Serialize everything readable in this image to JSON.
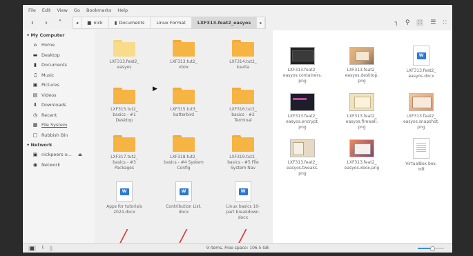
{
  "menu": [
    "File",
    "Edit",
    "View",
    "Go",
    "Bookmarks",
    "Help"
  ],
  "breadcrumbs": [
    {
      "label": "nick",
      "icon": "home-icon"
    },
    {
      "label": "Documents",
      "icon": "folder-icon"
    },
    {
      "label": "Linux Format",
      "icon": ""
    },
    {
      "label": "LXF313.feat2_easyos",
      "icon": ""
    }
  ],
  "sidebar": {
    "my_computer": "My Computer",
    "items": [
      {
        "label": "Home",
        "icon": "home-icon"
      },
      {
        "label": "Desktop",
        "icon": "desktop-icon"
      },
      {
        "label": "Documents",
        "icon": "documents-icon"
      },
      {
        "label": "Music",
        "icon": "music-icon"
      },
      {
        "label": "Pictures",
        "icon": "pictures-icon"
      },
      {
        "label": "Videos",
        "icon": "videos-icon"
      },
      {
        "label": "Downloads",
        "icon": "downloads-icon"
      },
      {
        "label": "Recent",
        "icon": "recent-icon"
      },
      {
        "label": "File System",
        "icon": "file-system-icon"
      },
      {
        "label": "Rubbish Bin",
        "icon": "rubbish-bin-icon"
      }
    ],
    "network_header": "Network",
    "network_items": [
      {
        "label": "nickpeers-o...",
        "icon": "computer-icon"
      },
      {
        "label": "Network",
        "icon": "network-icon"
      }
    ]
  },
  "left_items": [
    {
      "type": "folder-light",
      "lines": [
        "LXF313.feat2_",
        "easyos"
      ]
    },
    {
      "type": "folder",
      "lines": [
        "LXF313.tut2_",
        "vbox"
      ]
    },
    {
      "type": "folder",
      "lines": [
        "LXF314.tut2_",
        "kavita"
      ]
    },
    {
      "type": "folder",
      "lines": [
        "LXF315.tut2_",
        "basics - #1",
        "Desktop"
      ]
    },
    {
      "type": "folder",
      "lines": [
        "LXF315.tut3_",
        "batterbird"
      ]
    },
    {
      "type": "folder",
      "lines": [
        "LXF316.tut2_",
        "basics - #2",
        "Terminal"
      ]
    },
    {
      "type": "folder",
      "lines": [
        "LXF317.tut2_",
        "basics - #3",
        "Packages"
      ]
    },
    {
      "type": "folder",
      "lines": [
        "LXF318.tut2_",
        "basics - #4 System",
        "Config"
      ]
    },
    {
      "type": "folder",
      "lines": [
        "LXF319.tut2_",
        "basics - #5 File",
        "System Nav"
      ]
    },
    {
      "type": "docx",
      "lines": [
        "Apps for tutorials",
        "2024.docx"
      ]
    },
    {
      "type": "docx",
      "lines": [
        "Contribution List.",
        "docx"
      ]
    },
    {
      "type": "docx",
      "lines": [
        "Linux basics 10-",
        "part breakdown.",
        "docx"
      ]
    },
    {
      "type": "pdf",
      "lines": []
    },
    {
      "type": "pdf",
      "lines": []
    },
    {
      "type": "pdf",
      "lines": []
    }
  ],
  "right_items": [
    {
      "type": "dark",
      "lines": [
        "LXF313.feat2_",
        "easyos.containers.",
        "png"
      ]
    },
    {
      "type": "orange",
      "lines": [
        "LXF313.feat2_",
        "easyos.desktop.",
        "png"
      ]
    },
    {
      "type": "docx",
      "lines": [
        "LXF313.feat2_",
        "easyos.docx"
      ]
    },
    {
      "type": "term",
      "lines": [
        "LXF313.feat2_",
        "easyos.encrypt.",
        "png"
      ]
    },
    {
      "type": "cream",
      "lines": [
        "LXF313.feat2_",
        "easyos.firewall.",
        "png"
      ]
    },
    {
      "type": "snap",
      "lines": [
        "LXF313.feat2_",
        "easyos.snapshot.",
        "png"
      ]
    },
    {
      "type": "tweak",
      "lines": [
        "LXF313.feat2_",
        "easyos.tweaks.",
        "png"
      ]
    },
    {
      "type": "xbox",
      "lines": [
        "LXF313.feat2_",
        "easyos.xbox.png"
      ]
    },
    {
      "type": "paper",
      "lines": [
        "VirtualBox box.",
        "odt"
      ]
    }
  ],
  "status": {
    "text": "9 items, Free space: 106.5 GB",
    "zoom_fraction": 0.55
  },
  "icons": {
    "back": "back-icon",
    "forward": "forward-icon",
    "up": "up-icon",
    "toggle_path": "toggle-path-icon",
    "crumb_left": "crumb-left-icon",
    "crumb_right": "crumb-right-icon",
    "open_terminal": "terminal-icon",
    "search": "search-icon",
    "icon_view": "icon-view-icon",
    "list_view": "list-view-icon",
    "compact_view": "compact-view-icon"
  }
}
